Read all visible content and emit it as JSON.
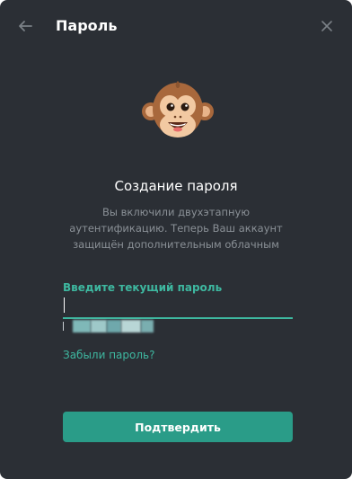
{
  "header": {
    "title": "Пароль",
    "back_icon": "arrow-left-icon",
    "close_icon": "close-icon"
  },
  "illustration": {
    "icon": "monkey-emoji-icon"
  },
  "main": {
    "heading": "Создание пароля",
    "description": "Вы включили двухэтапную аутентификацию. Теперь Ваш аккаунт защищён дополнительным облачным"
  },
  "form": {
    "field_label": "Введите текущий пароль",
    "password_value": "",
    "forgot_link": "Забыли пароль?",
    "submit_label": "Подтвердить"
  },
  "colors": {
    "background": "#2b2f35",
    "accent": "#3eb8a0",
    "button": "#2a9c88",
    "muted_text": "#8a9096"
  }
}
